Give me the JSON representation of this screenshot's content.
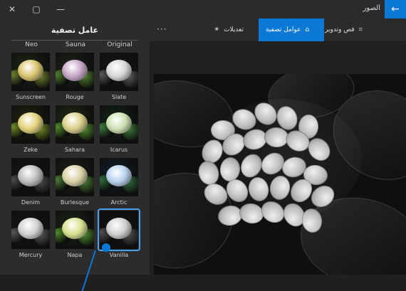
{
  "window": {
    "title": "الصور",
    "controls": [
      "✕",
      "▢",
      "—"
    ],
    "back_icon": "back-arrow-icon"
  },
  "toolbar": {
    "crop_label": "قص وتدوير",
    "filters_label": "عوامل تصفية",
    "adjust_label": "تعديلات",
    "more_label": "···"
  },
  "filters_panel": {
    "title": "عامل تصفية",
    "columns": [
      "Neo",
      "Sauna",
      "Original"
    ],
    "items": [
      {
        "label": "Sunscreen",
        "tone": "warm"
      },
      {
        "label": "Rouge",
        "tone": "rose"
      },
      {
        "label": "Slate",
        "tone": "mono"
      },
      {
        "label": "Zeke",
        "tone": "yellow"
      },
      {
        "label": "Sahara",
        "tone": "warm2"
      },
      {
        "label": "Icarus",
        "tone": "green"
      },
      {
        "label": "Denim",
        "tone": "mono2"
      },
      {
        "label": "Burlesque",
        "tone": "cool"
      },
      {
        "label": "Arctic",
        "tone": "blue"
      },
      {
        "label": "Mercury",
        "tone": "mono3"
      },
      {
        "label": "Napa",
        "tone": "pastel"
      },
      {
        "label": "Vanilla",
        "tone": "mono4",
        "selected": true
      }
    ]
  },
  "colors": {
    "accent": "#0b78d6",
    "panel": "#2c2c2c",
    "bg": "#1f1f1f"
  }
}
